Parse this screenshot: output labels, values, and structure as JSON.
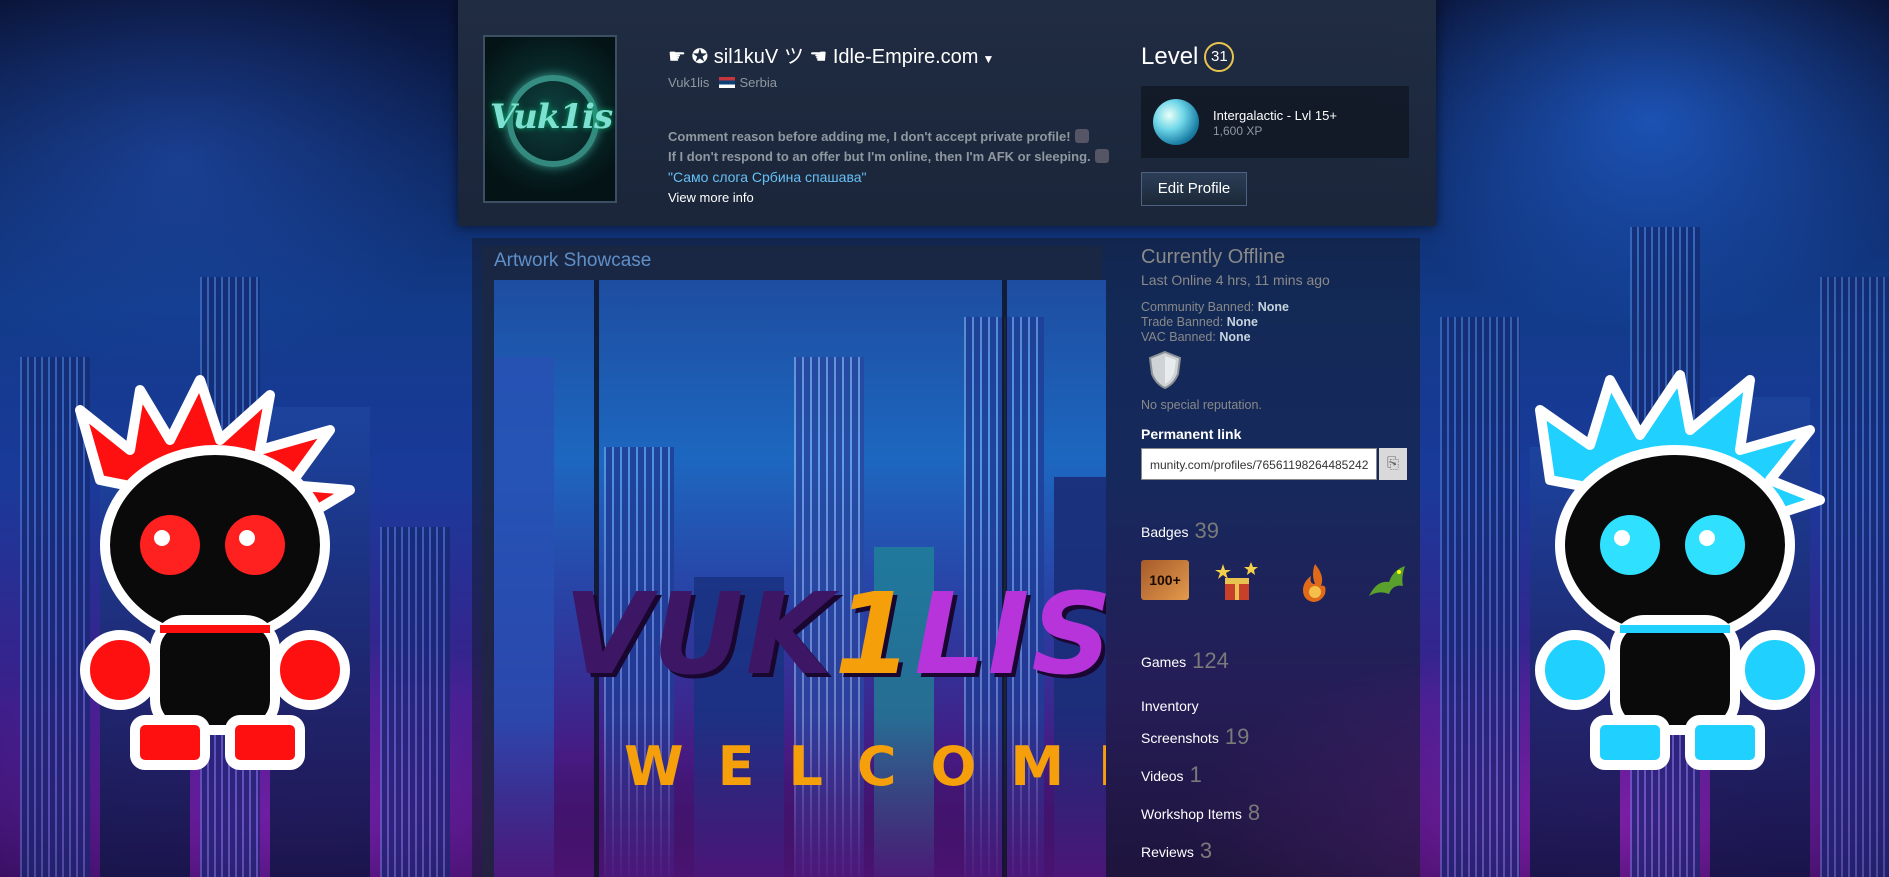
{
  "header": {
    "persona_name": "☛ ✪ sil1kuV ツ ☚ Idle-Empire.com",
    "real_name": "Vuk1lis",
    "country": "Serbia",
    "avatar_text": "Vuk1is",
    "summary_lines": [
      "Comment reason before adding me, I don't accept private profile!",
      "If I don't respond to an offer but I'm online, then I'm AFK or sleeping."
    ],
    "summary_quote": "\"Само слога Србина спашава\"",
    "view_more": "View more info",
    "level_label": "Level",
    "level": "31",
    "favorite_badge": {
      "name": "Intergalactic - Lvl 15+",
      "xp": "1,600 XP"
    },
    "edit_profile": "Edit Profile"
  },
  "showcase": {
    "title": "Artwork Showcase",
    "art_title_a": "VUK",
    "art_title_b": "1",
    "art_title_c": "LIS",
    "art_subtitle": "WELCOME"
  },
  "sidebar": {
    "status": "Currently Offline",
    "last_online": "Last Online 4 hrs, 11 mins ago",
    "bans": [
      {
        "label": "Community Banned:",
        "value": "None"
      },
      {
        "label": "Trade Banned:",
        "value": "None"
      },
      {
        "label": "VAC Banned:",
        "value": "None"
      }
    ],
    "reputation": "No special reputation.",
    "permanent_link_label": "Permanent link",
    "permanent_link": "munity.com/profiles/76561198264485242",
    "badges": {
      "label": "Badges",
      "count": "39",
      "first_badge_text": "100+"
    },
    "games": {
      "label": "Games",
      "count": "124"
    },
    "inventory": {
      "label": "Inventory"
    },
    "screenshots": {
      "label": "Screenshots",
      "count": "19"
    },
    "videos": {
      "label": "Videos",
      "count": "1"
    },
    "workshop": {
      "label": "Workshop Items",
      "count": "8"
    },
    "reviews": {
      "label": "Reviews",
      "count": "3"
    }
  },
  "colors": {
    "accent_blue": "#66c0f4",
    "level_ring": "#e8c350",
    "chibi_left": "#ff1a1a",
    "chibi_right": "#22d8ff",
    "welcome_orange": "#f5a00b"
  }
}
